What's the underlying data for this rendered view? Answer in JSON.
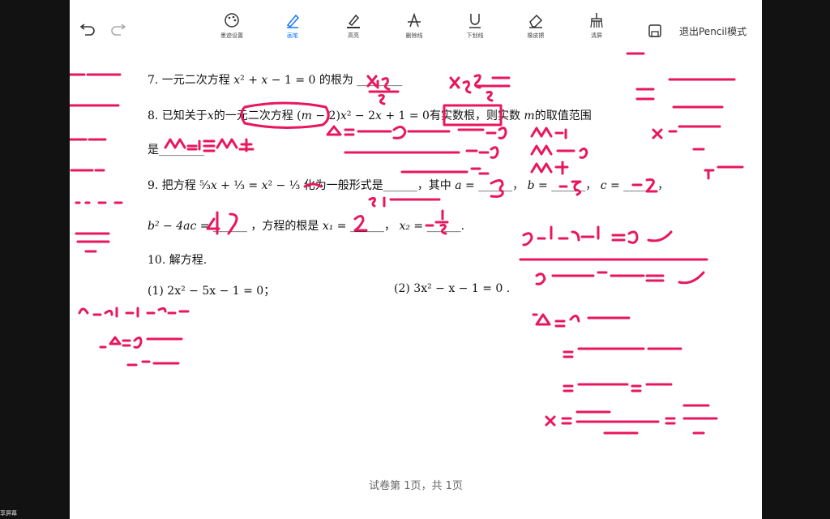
{
  "toolbar": {
    "undo": "undo",
    "redo": "redo",
    "tools": [
      {
        "label": "墨迹设置",
        "icon": "palette-icon"
      },
      {
        "label": "画笔",
        "icon": "pen-icon"
      },
      {
        "label": "高亮",
        "icon": "highlighter-icon"
      },
      {
        "label": "删除线",
        "icon": "strikethrough-icon"
      },
      {
        "label": "下划线",
        "icon": "underline-icon"
      },
      {
        "label": "橡皮擦",
        "icon": "eraser-icon"
      },
      {
        "label": "清屏",
        "icon": "broom-icon"
      }
    ],
    "exit_label": "退出Pencil模式"
  },
  "questions": {
    "q7": {
      "prefix": "7.  一元二次方程",
      "suffix": "的根为",
      "blank": "________"
    },
    "q8": {
      "prefix": "8.  已知关于",
      "var": "x",
      "middle": "的一元二次方程",
      "tail": "有实数根，则实数",
      "var_m": "m",
      "end": "的取值范围",
      "line2": "是",
      "blank": "________"
    },
    "q9": {
      "prefix": "9.  把方程",
      "middle": "化为一般形式是",
      "blank": "______",
      "comma_a": "，其中",
      "a_eq": "a =",
      "b_eq": "b =",
      "c_eq": "c =",
      "line2_disc": "b² − 4ac =",
      "line2_mid": "，方程的根是",
      "x1": "x₁ =",
      "x2": "x₂ ="
    },
    "q10": {
      "title": "10.  解方程.",
      "p1": "(1) 2x² − 5x − 1 = 0；",
      "p2": "(2) 3x² − x − 1 = 0 ."
    }
  },
  "footer": "试卷第 1页，共 1页",
  "share_tag": "享屏幕",
  "colors": {
    "ink": "#e8175d",
    "accent": "#1677ff"
  }
}
